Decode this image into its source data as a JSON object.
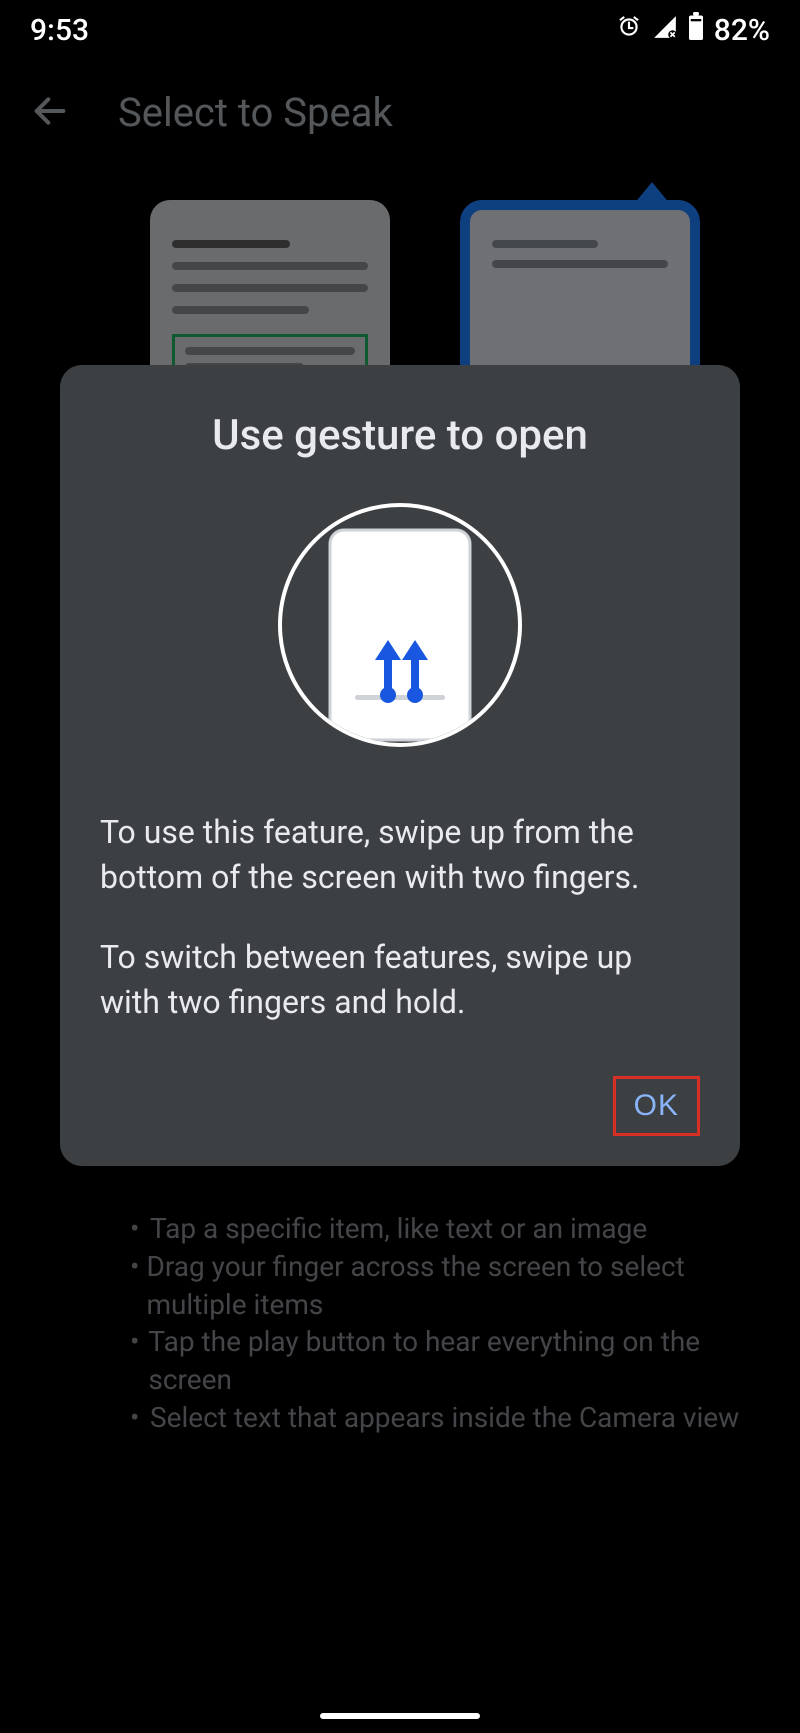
{
  "status": {
    "time": "9:53",
    "battery": "82%"
  },
  "appbar": {
    "title": "Select to Speak"
  },
  "background": {
    "bullets": [
      "Tap a specific item, like text or an image",
      "Drag your finger across the screen to select multiple items",
      "Tap the play button to hear everything on the screen",
      "Select text that appears inside the Camera view"
    ]
  },
  "dialog": {
    "title": "Use gesture to open",
    "paragraph1": "To use this feature, swipe up from the bottom of the screen with two fingers.",
    "paragraph2": "To switch between features, swipe up with two fingers and hold.",
    "ok": "OK"
  }
}
